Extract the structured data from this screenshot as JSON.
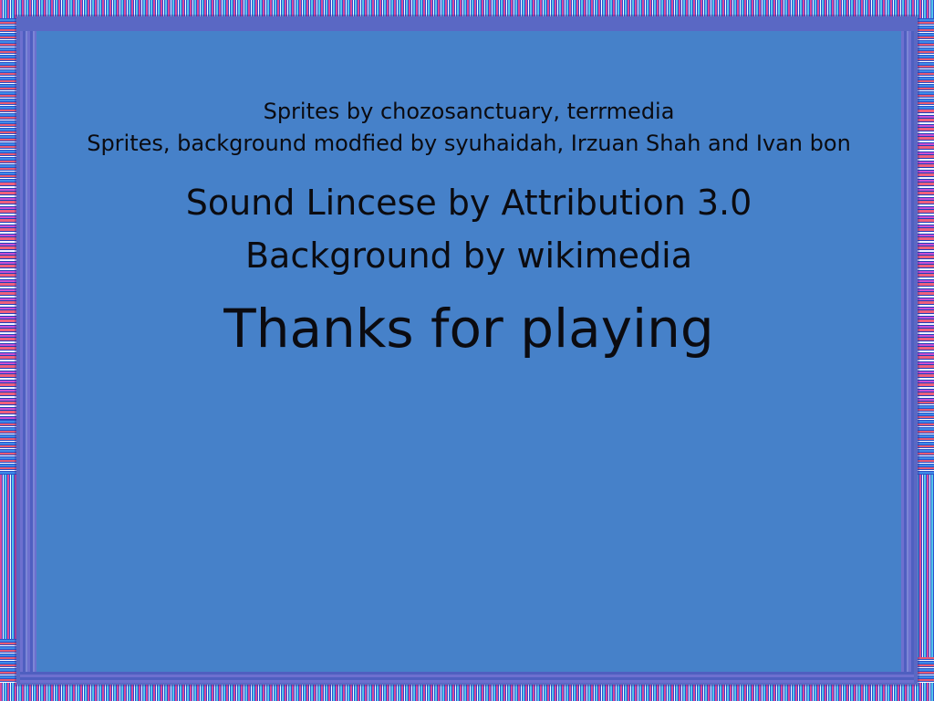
{
  "credits": {
    "line1": "Sprites by chozosanctuary, terrmedia",
    "line2": "Sprites, background modfied by syuhaidah, Irzuan Shah and Ivan bon",
    "line3": "Sound Lincese by Attribution 3.0",
    "line4": "Background by wikimedia",
    "thanks": "Thanks for playing"
  },
  "colors": {
    "panel": "#4681c9",
    "frame": "#5a68c4",
    "text": "#0b0b10",
    "stripe_red": "#e0506a",
    "stripe_blue": "#2e6fd6",
    "stripe_magenta": "#d040c8",
    "stripe_cyan": "#6fd8ee"
  }
}
